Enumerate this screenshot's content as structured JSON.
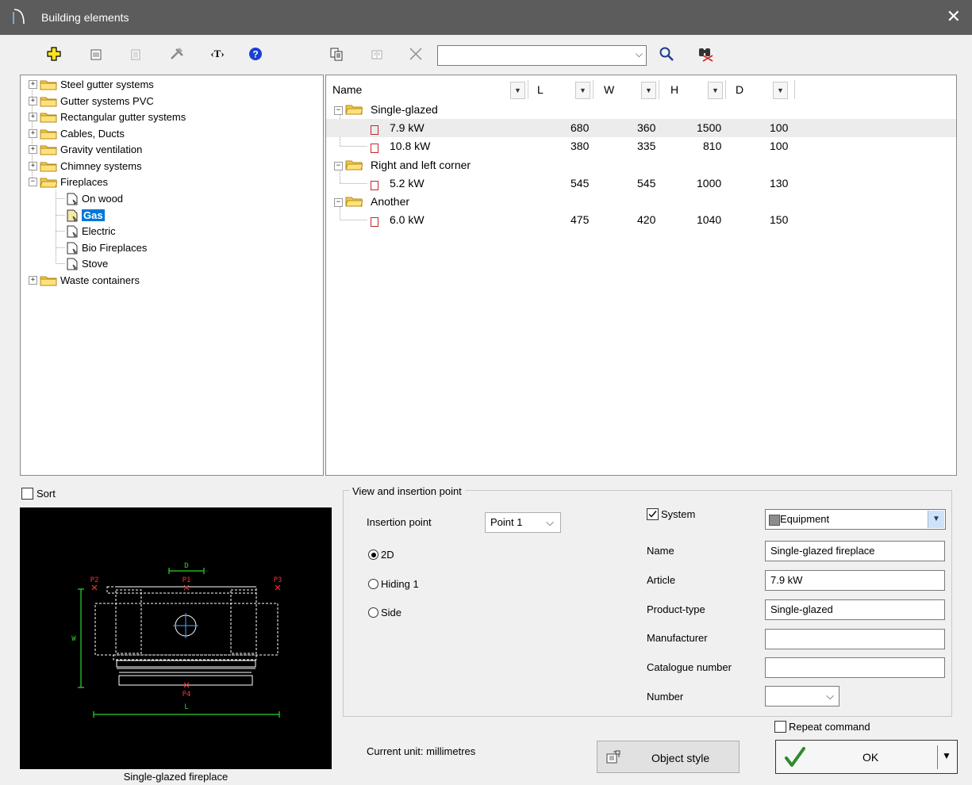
{
  "window": {
    "title": "Building elements",
    "close_glyph": "✕"
  },
  "search": {
    "value": "",
    "placeholder": ""
  },
  "tree": {
    "items": [
      {
        "label": "Steel gutter systems",
        "expander": "+"
      },
      {
        "label": "Gutter systems PVC",
        "expander": "+"
      },
      {
        "label": "Rectangular gutter systems",
        "expander": "+"
      },
      {
        "label": "Cables, Ducts",
        "expander": "+"
      },
      {
        "label": "Gravity ventilation",
        "expander": "+"
      },
      {
        "label": "Chimney systems",
        "expander": "+"
      },
      {
        "label": "Fireplaces",
        "expander": "−"
      },
      {
        "label": "On wood"
      },
      {
        "label": "Gas",
        "selected": true
      },
      {
        "label": "Electric"
      },
      {
        "label": "Bio Fireplaces"
      },
      {
        "label": "Stove"
      },
      {
        "label": "Waste containers",
        "expander": "+"
      }
    ]
  },
  "list": {
    "columns": [
      "Name",
      "L",
      "W",
      "H",
      "D"
    ],
    "groups": [
      {
        "name": "Single-glazed",
        "rows": [
          {
            "name": "7.9 kW",
            "l": "680",
            "w": "360",
            "h": "1500",
            "d": "100",
            "highlighted": true
          },
          {
            "name": "10.8 kW",
            "l": "380",
            "w": "335",
            "h": "810",
            "d": "100"
          }
        ]
      },
      {
        "name": "Right and left corner",
        "rows": [
          {
            "name": "5.2 kW",
            "l": "545",
            "w": "545",
            "h": "1000",
            "d": "130"
          }
        ]
      },
      {
        "name": "Another",
        "rows": [
          {
            "name": "6.0 kW",
            "l": "475",
            "w": "420",
            "h": "1040",
            "d": "150"
          }
        ]
      }
    ]
  },
  "sort": {
    "label": "Sort",
    "checked": false
  },
  "preview": {
    "caption": "Single-glazed fireplace",
    "point_labels": [
      "P2",
      "P1",
      "P3",
      "P4"
    ],
    "dim_labels": {
      "top": "D",
      "left": "W",
      "bottom": "L"
    }
  },
  "view_group": {
    "legend": "View and insertion point",
    "insertion_label": "Insertion point",
    "insertion_value": "Point 1",
    "radios": [
      {
        "label": "2D",
        "checked": true
      },
      {
        "label": "Hiding 1",
        "checked": false
      },
      {
        "label": "Side",
        "checked": false
      }
    ]
  },
  "props": {
    "system_label": "System",
    "system_checked": true,
    "system_value": "Equipment",
    "name_label": "Name",
    "name_value": "Single-glazed fireplace",
    "article_label": "Article",
    "article_value": "7.9 kW",
    "product_type_label": "Product-type",
    "product_type_value": "Single-glazed",
    "manufacturer_label": "Manufacturer",
    "manufacturer_value": "",
    "catalogue_label": "Catalogue number",
    "catalogue_value": "",
    "number_label": "Number",
    "number_value": ""
  },
  "footer": {
    "repeat_label": "Repeat command",
    "repeat_checked": false,
    "unit_text": "Current unit: millimetres",
    "object_style_label": "Object style",
    "ok_label": "OK"
  },
  "colors": {
    "selection": "#0078d7",
    "titlebar": "#5c5c5c",
    "accent_red": "#c0282d",
    "ok_check": "#2e8b2e"
  }
}
